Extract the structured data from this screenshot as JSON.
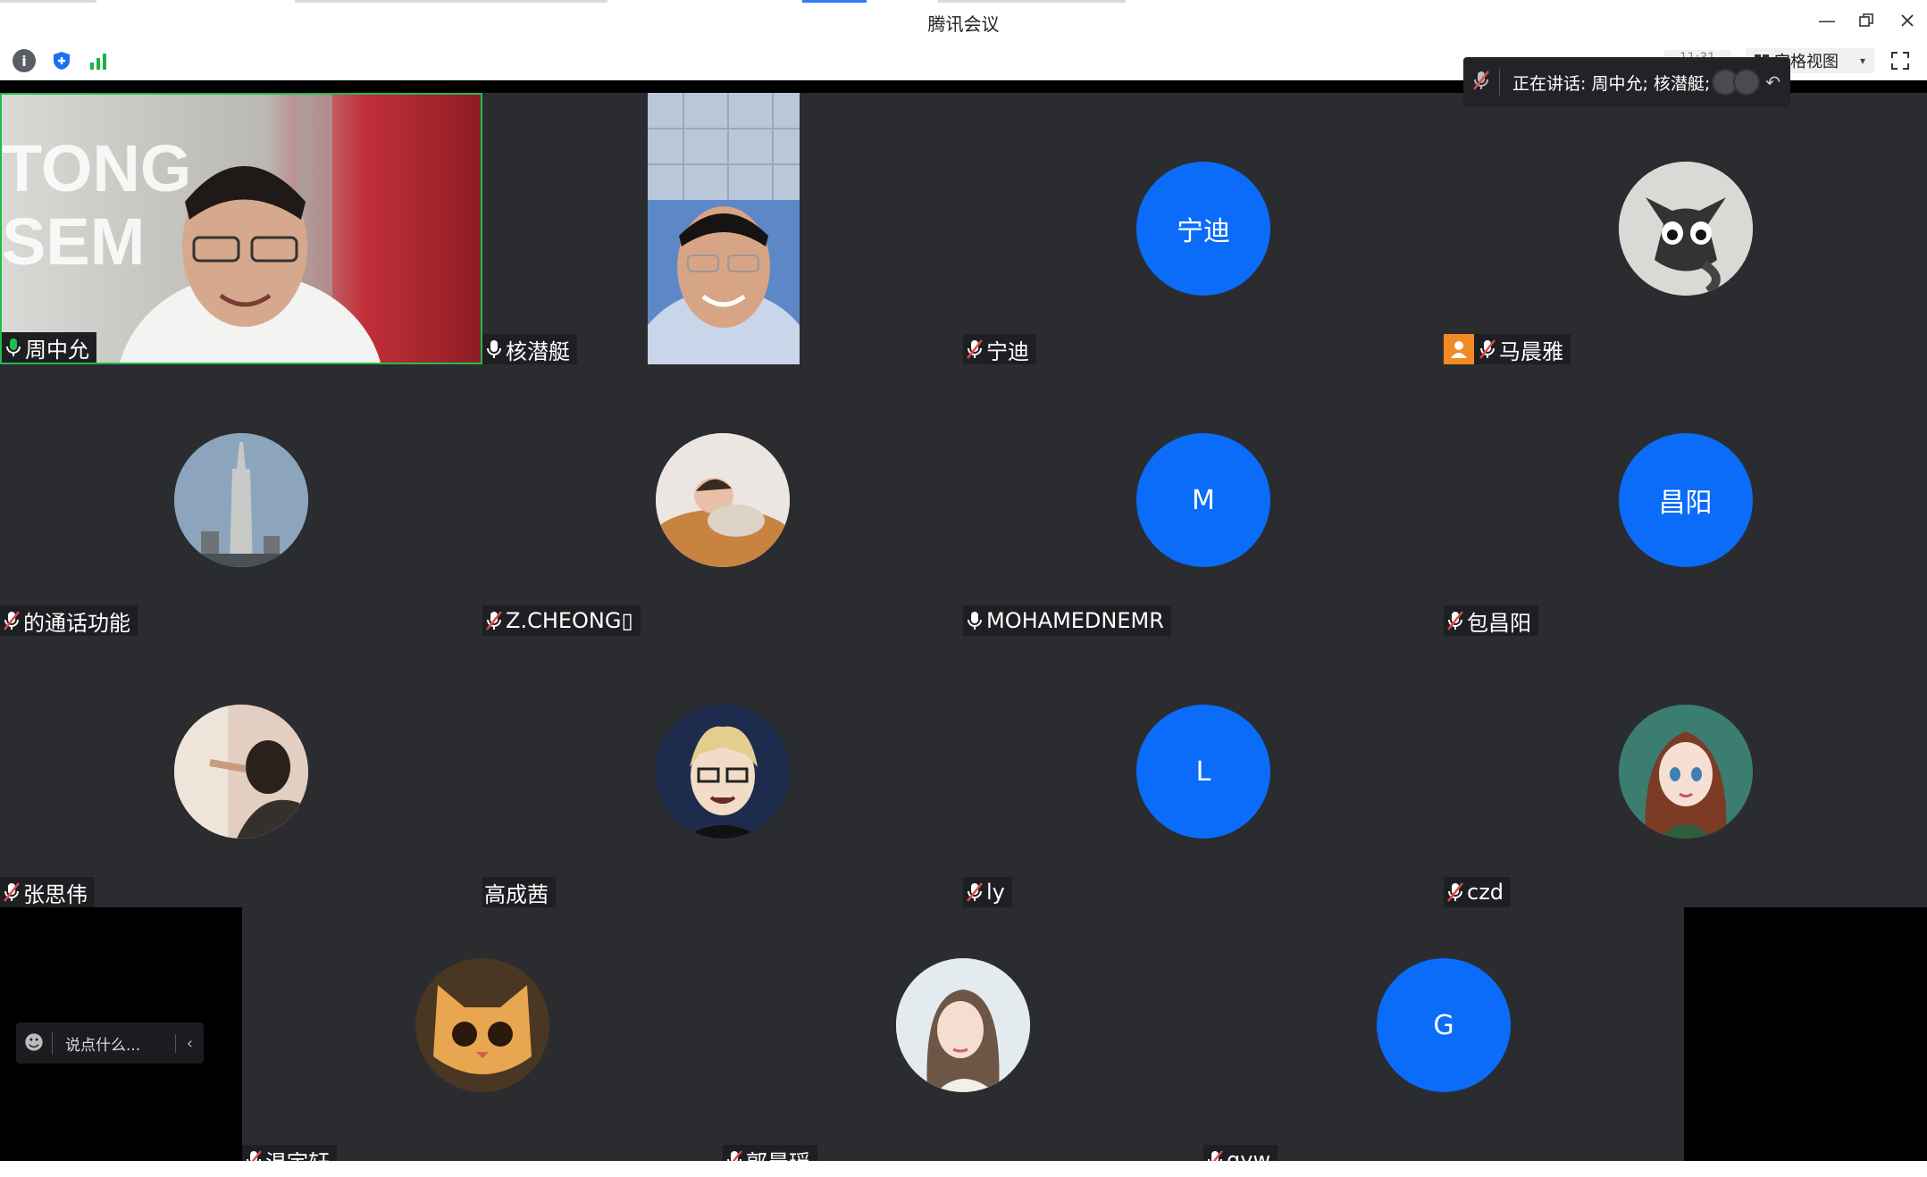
{
  "window": {
    "title": "腾讯会议"
  },
  "toolbar": {
    "time_text": "11:31",
    "view_label": "宫格视图"
  },
  "speaking": {
    "label": "正在讲话: 周中允; 核潜艇;"
  },
  "chat": {
    "placeholder": "说点什么..."
  },
  "participants": [
    {
      "name": "周中允",
      "mic": "on",
      "kind": "video",
      "active": true
    },
    {
      "name": "核潜艇",
      "mic": "on",
      "kind": "video"
    },
    {
      "name": "宁迪",
      "mic": "muted",
      "kind": "text",
      "avatar_text": "宁迪"
    },
    {
      "name": "马晨雅",
      "mic": "muted",
      "kind": "image",
      "avatar_icon": "cat-sketch-avatar",
      "host": true
    },
    {
      "name": "的通话功能",
      "mic": "muted",
      "kind": "image",
      "avatar_icon": "tower-avatar"
    },
    {
      "name": "Z.CHEONG▯",
      "mic": "muted",
      "kind": "image",
      "avatar_icon": "sleeping-child-avatar"
    },
    {
      "name": "MOHAMEDNEMR",
      "mic": "on",
      "kind": "text",
      "avatar_text": "M"
    },
    {
      "name": "包昌阳",
      "mic": "muted",
      "kind": "text",
      "avatar_text": "昌阳"
    },
    {
      "name": "张思伟",
      "mic": "muted",
      "kind": "image",
      "avatar_icon": "photo-avatar"
    },
    {
      "name": "高成茜",
      "mic": "none",
      "kind": "image",
      "avatar_icon": "anime-glasses-avatar"
    },
    {
      "name": "ly",
      "mic": "muted",
      "kind": "text",
      "avatar_text": "L"
    },
    {
      "name": "czd",
      "mic": "muted",
      "kind": "image",
      "avatar_icon": "anime-girl-avatar"
    },
    {
      "name": "温宇轩",
      "mic": "muted",
      "kind": "image",
      "avatar_icon": "orange-cat-avatar"
    },
    {
      "name": "郭晨瑶",
      "mic": "muted",
      "kind": "image",
      "avatar_icon": "illustrated-woman-avatar"
    },
    {
      "name": "gyw",
      "mic": "muted",
      "kind": "text",
      "avatar_text": "G"
    }
  ],
  "colors": {
    "avatar_blue": "#0a6cf8",
    "speaking_green": "#1fbd4d",
    "muted_red": "#e04848",
    "tile_bg": "#2a2c30"
  }
}
